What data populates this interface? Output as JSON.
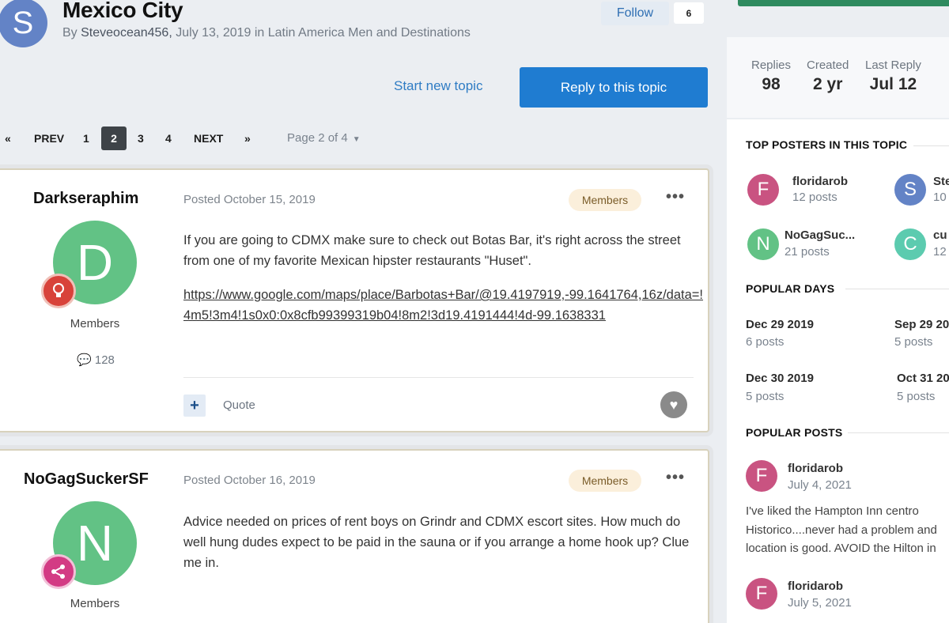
{
  "topic": {
    "avatar_letter": "S",
    "title": "Mexico City",
    "by_label": "By",
    "author": "Steveocean456,",
    "meta": "July 13, 2019 in Latin America Men and Destinations",
    "follow_label": "Follow",
    "follow_count": "6",
    "start_new_topic": "Start new topic",
    "reply_label": "Reply to this topic"
  },
  "pagination": {
    "first": "«",
    "prev": "PREV",
    "pages": [
      "1",
      "2",
      "3",
      "4"
    ],
    "current_page": "2",
    "next": "NEXT",
    "last": "»",
    "page_info": "Page 2 of 4"
  },
  "posts": [
    {
      "username": "Darkseraphim",
      "avatar_letter": "D",
      "group": "Members",
      "post_count": "128",
      "posted": "Posted October 15, 2019",
      "badge": "Members",
      "content": "If you are going to CDMX make sure to check out Botas Bar, it's right across the street from one of my favorite Mexican hipster restaurants \"Huset\".",
      "link": "https://www.google.com/maps/place/Barbotas+Bar/@19.4197919,-99.1641764,16z/data=!4m5!3m4!1s0x0:0x8cfb99399319b04!8m2!3d19.4191444!4d-99.1638331",
      "quote_label": "Quote"
    },
    {
      "username": "NoGagSuckerSF",
      "avatar_letter": "N",
      "group": "Members",
      "posted": "Posted October 16, 2019",
      "badge": "Members",
      "content": "Advice needed on prices of rent boys on Grindr and CDMX escort sites. How much do well hung dudes expect to be paid in the sauna or if you arrange a home hook up? Clue me in."
    }
  ],
  "sidebar": {
    "stats": [
      {
        "label": "Replies",
        "value": "98"
      },
      {
        "label": "Created",
        "value": "2 yr"
      },
      {
        "label": "Last Reply",
        "value": "Jul 12"
      }
    ],
    "top_posters_heading": "TOP POSTERS IN THIS TOPIC",
    "top_posters": [
      {
        "letter": "F",
        "name": "floridarob",
        "count": "12 posts",
        "color": "#c95381"
      },
      {
        "letter": "S",
        "name": "Ste",
        "count": "10",
        "color": "#6383c6"
      },
      {
        "letter": "N",
        "name": "NoGagSuc...",
        "count": "21 posts",
        "color": "#62c285"
      },
      {
        "letter": "C",
        "name": "cu",
        "count": "12",
        "color": "#5ccbaf"
      }
    ],
    "popular_days_heading": "POPULAR DAYS",
    "popular_days": [
      {
        "date": "Dec 29 2019",
        "count": "6 posts"
      },
      {
        "date": "Sep 29 20",
        "count": "5 posts"
      },
      {
        "date": "Dec 30 2019",
        "count": "5 posts"
      },
      {
        "date": "Oct 31 20",
        "count": "5 posts"
      }
    ],
    "popular_posts_heading": "POPULAR POSTS",
    "popular_posts": [
      {
        "letter": "F",
        "name": "floridarob",
        "date": "July 4, 2021",
        "text": "I've liked the Hampton Inn centro Historico....never had a problem and location is good. AVOID the Hilton in"
      },
      {
        "letter": "F",
        "name": "floridarob",
        "date": "July 5, 2021",
        "text": ""
      }
    ],
    "avatar_color": "#c95381"
  },
  "colors": {
    "accent": "#1f7cd1",
    "link": "#2f7cc4",
    "background": "#ebeef2",
    "sidebar_bar": "#2e8a5f"
  }
}
